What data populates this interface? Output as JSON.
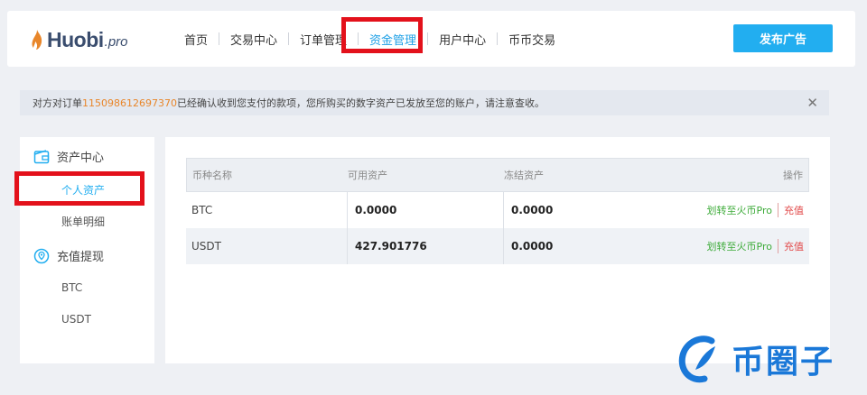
{
  "header": {
    "brand": "Huobi",
    "brand_suffix": ".pro",
    "nav": [
      {
        "label": "首页"
      },
      {
        "label": "交易中心"
      },
      {
        "label": "订单管理"
      },
      {
        "label": "资金管理",
        "active": true
      },
      {
        "label": "用户中心"
      },
      {
        "label": "币币交易"
      }
    ],
    "publish_button": "发布广告"
  },
  "notice": {
    "prefix": "对方对订单",
    "order_no": "115098612697370",
    "suffix": "已经确认收到您支付的款项，您所购买的数字资产已发放至您的账户，请注意查收。",
    "close_icon": "close-icon"
  },
  "sidebar": {
    "asset_center": "资产中心",
    "personal_assets": "个人资产",
    "bill_details": "账单明细",
    "deposit_withdraw": "充值提现",
    "btc": "BTC",
    "usdt": "USDT"
  },
  "table": {
    "headers": [
      "币种名称",
      "可用资产",
      "冻结资产",
      "操作"
    ],
    "rows": [
      {
        "coin": "BTC",
        "available": "0.0000",
        "frozen": "0.0000",
        "transfer": "划转至火币Pro",
        "deposit": "充值"
      },
      {
        "coin": "USDT",
        "available": "427.901776",
        "frozen": "0.0000",
        "transfer": "划转至火币Pro",
        "deposit": "充值"
      }
    ]
  },
  "watermark": {
    "text": "币圈子"
  },
  "colors": {
    "accent": "#22aef0",
    "highlight_box": "#e3111b",
    "order_no": "#e8862a",
    "transfer": "#3dab39",
    "deposit": "#e24a4a"
  }
}
